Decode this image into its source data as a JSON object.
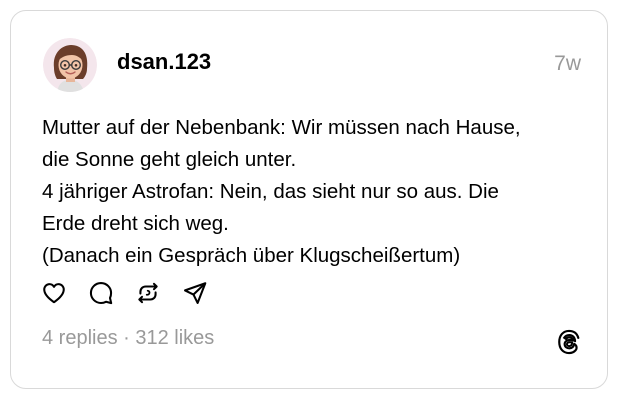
{
  "post": {
    "author": {
      "username": "dsan.123",
      "avatar_icon": "memoji-avatar-icon"
    },
    "timestamp": "7w",
    "lines": [
      "Mutter auf der Nebenbank: Wir müssen nach Hause,",
      "die Sonne geht gleich unter.",
      "4 jähriger Astrofan: Nein, das sieht nur so aus. Die",
      "Erde dreht sich weg.",
      "(Danach ein Gespräch über Klugscheißertum)"
    ],
    "actions": {
      "like_icon": "heart-icon",
      "reply_icon": "comment-icon",
      "repost_icon": "repost-icon",
      "share_icon": "send-icon"
    },
    "stats": "4 replies · 312 likes",
    "brand_icon": "threads-logo-icon"
  },
  "colors": {
    "text": "#000000",
    "muted": "#999999",
    "border": "#d9d9d9"
  }
}
